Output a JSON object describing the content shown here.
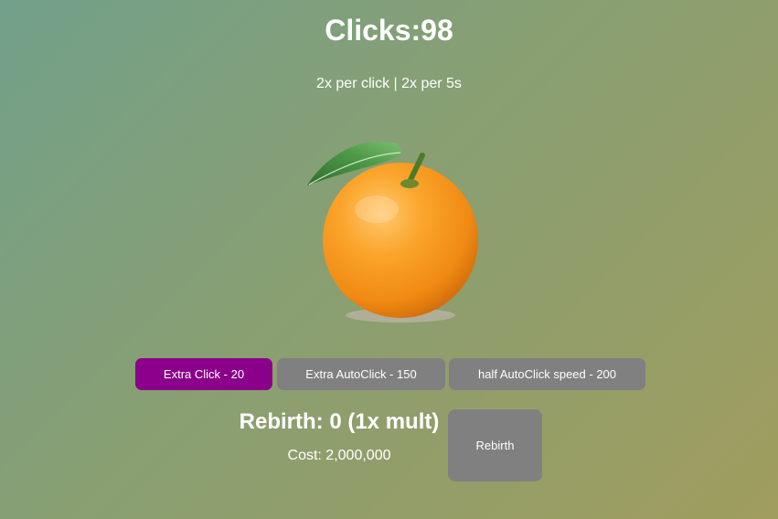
{
  "clicks_display": "Clicks:98",
  "rate_info": "2x per click | 2x per 5s",
  "colors": {
    "upgrade_active": "#8a008a",
    "button_gray": "#808080",
    "orange": "#f79a1c",
    "leaf": "#3e8a3a"
  },
  "upgrades": [
    {
      "label": "Extra Click - 20",
      "state": "affordable"
    },
    {
      "label": "Extra AutoClick - 150",
      "state": "locked"
    },
    {
      "label": "half AutoClick speed - 200",
      "state": "locked"
    }
  ],
  "rebirth": {
    "title": "Rebirth: 0 (1x mult)",
    "cost": "Cost: 2,000,000",
    "button_label": "Rebirth"
  },
  "icons": {
    "clicker": "orange-icon"
  }
}
